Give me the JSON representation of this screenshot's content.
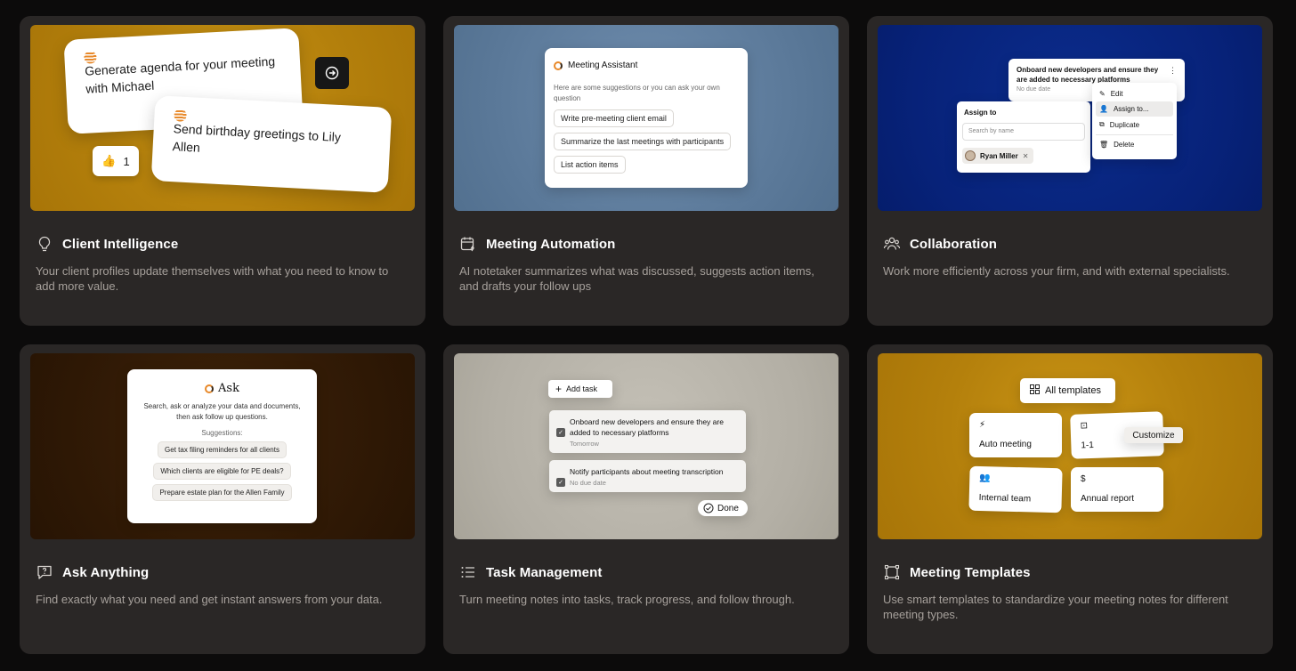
{
  "cards": [
    {
      "title": "Client Intelligence",
      "description": "Your client profiles update themselves with what you need to know to add more value.",
      "icon": "lightbulb-icon",
      "bubble1": "Generate agenda for your meeting with Michael",
      "bubble2": "Send birthday greetings to Lily Allen",
      "reaction_count": "1"
    },
    {
      "title": "Meeting Automation",
      "description": "AI notetaker summarizes what was discussed, suggests action items, and drafts your follow ups",
      "icon": "calendar-bolt-icon",
      "assistant_title": "Meeting Assistant",
      "assistant_intro": "Here are some suggestions or you can ask your own question",
      "suggestions": [
        "Write pre-meeting client email",
        "Summarize the last meetings with participants",
        "List action items"
      ]
    },
    {
      "title": "Collaboration",
      "description": "Work more efficiently across your firm, and with external specialists.",
      "icon": "people-icon",
      "task_title": "Onboard new developers and ensure they are added to necessary platforms",
      "task_due": "No due date",
      "assign_heading": "Assign to",
      "search_placeholder": "Search by name",
      "assignee": "Ryan Miller",
      "menu": [
        "Edit",
        "Assign to...",
        "Duplicate",
        "Delete"
      ]
    },
    {
      "title": "Ask Anything",
      "description": "Find exactly what you need and get instant answers from your data.",
      "icon": "chat-question-icon",
      "ask_title": "Ask",
      "ask_intro": "Search, ask or analyze your data and documents, then ask follow up questions.",
      "suggestions_label": "Suggestions:",
      "suggestions": [
        "Get tax filing reminders for all clients",
        "Which clients are eligible for PE deals?",
        "Prepare estate plan for the Allen Family"
      ]
    },
    {
      "title": "Task Management",
      "description": "Turn meeting notes into tasks, track progress, and follow through.",
      "icon": "list-icon",
      "add_task": "Add task",
      "tasks": [
        {
          "title": "Onboard new developers and ensure they are added to necessary platforms",
          "due": "Tomorrow"
        },
        {
          "title": "Notify participants about meeting transcription",
          "due": "No due date"
        }
      ],
      "done_label": "Done"
    },
    {
      "title": "Meeting Templates",
      "description": "Use smart templates to standardize your meeting notes for different meeting types.",
      "icon": "frame-icon",
      "all_templates": "All templates",
      "templates": [
        {
          "icon": "bolt-icon",
          "label": "Auto meeting"
        },
        {
          "icon": "person-badge-icon",
          "label": "1-1"
        },
        {
          "icon": "people-icon",
          "label": "Internal team"
        },
        {
          "icon": "dollar-icon",
          "label": "Annual report"
        }
      ],
      "customize": "Customize"
    }
  ]
}
